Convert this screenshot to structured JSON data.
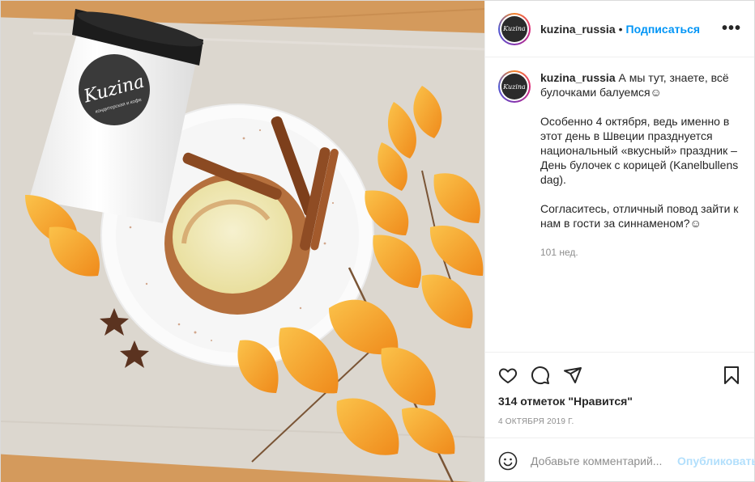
{
  "post": {
    "username": "kuzina_russia",
    "avatar_text": "Kuzina",
    "follow_label": "Подписаться",
    "separator": "•",
    "more_label": "•••"
  },
  "caption": {
    "username": "kuzina_russia",
    "line1": "А мы тут, знаете, всё булочками балуемся☺",
    "paragraph2": "Особенно 4 октября, ведь именно в этот день в Швеции празднуется национальный «вкусный» праздник – День булочек с корицей (Kanelbullens dag).",
    "paragraph3": "Согласитесь, отличный повод зайти к нам в гости за синнаменом?☺",
    "time_ago": "101 нед."
  },
  "photo": {
    "cup_logo": "Kuzina",
    "cup_subtitle": "кондитерская и кофе"
  },
  "actions": {
    "icons": [
      "heart-icon",
      "comment-icon",
      "share-icon",
      "bookmark-icon"
    ],
    "likes_text": "314 отметок \"Нравится\"",
    "date_text": "4 октября 2019 г."
  },
  "comment": {
    "placeholder": "Добавьте комментарий...",
    "publish_label": "Опубликовать"
  },
  "colors": {
    "accent": "#0095f6",
    "publish_disabled": "#b2dffc",
    "muted": "#8e8e8e"
  }
}
